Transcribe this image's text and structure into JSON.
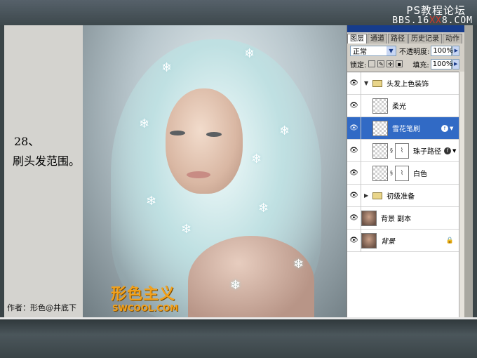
{
  "site": {
    "title": "PS教程论坛",
    "url_prefix": "BBS.16",
    "url_red": "XX",
    "url_suffix": "8.COM"
  },
  "left_panel": {
    "step_number": "28、",
    "step_text": "刷头发范围。",
    "author": "作者：形色@井底下"
  },
  "watermark": {
    "logo": "形色主义",
    "url": "SWCOOL.COM"
  },
  "palette": {
    "tabs": [
      "图层",
      "通道",
      "路径",
      "历史记录",
      "动作"
    ],
    "active_tab": "图层",
    "blend_mode": "正常",
    "opacity_label": "不透明度:",
    "opacity_value": "100%",
    "lock_label": "锁定:",
    "fill_label": "填充:",
    "fill_value": "100%",
    "layers": [
      {
        "name": "头发上色装饰",
        "kind": "group-open"
      },
      {
        "name": "柔光",
        "kind": "layer"
      },
      {
        "name": "雪花笔刷",
        "kind": "layer-selected",
        "fx": true
      },
      {
        "name": "珠子路径",
        "kind": "layer-mask",
        "fx": true
      },
      {
        "name": "白色",
        "kind": "layer-mask"
      },
      {
        "name": "初级准备",
        "kind": "group-closed"
      },
      {
        "name": "背景 副本",
        "kind": "photo"
      },
      {
        "name": "背景",
        "kind": "photo-locked"
      }
    ]
  },
  "colors": {
    "selection": "#316ac5",
    "frame": "#3b4548",
    "watermark": "#f2a11c"
  }
}
